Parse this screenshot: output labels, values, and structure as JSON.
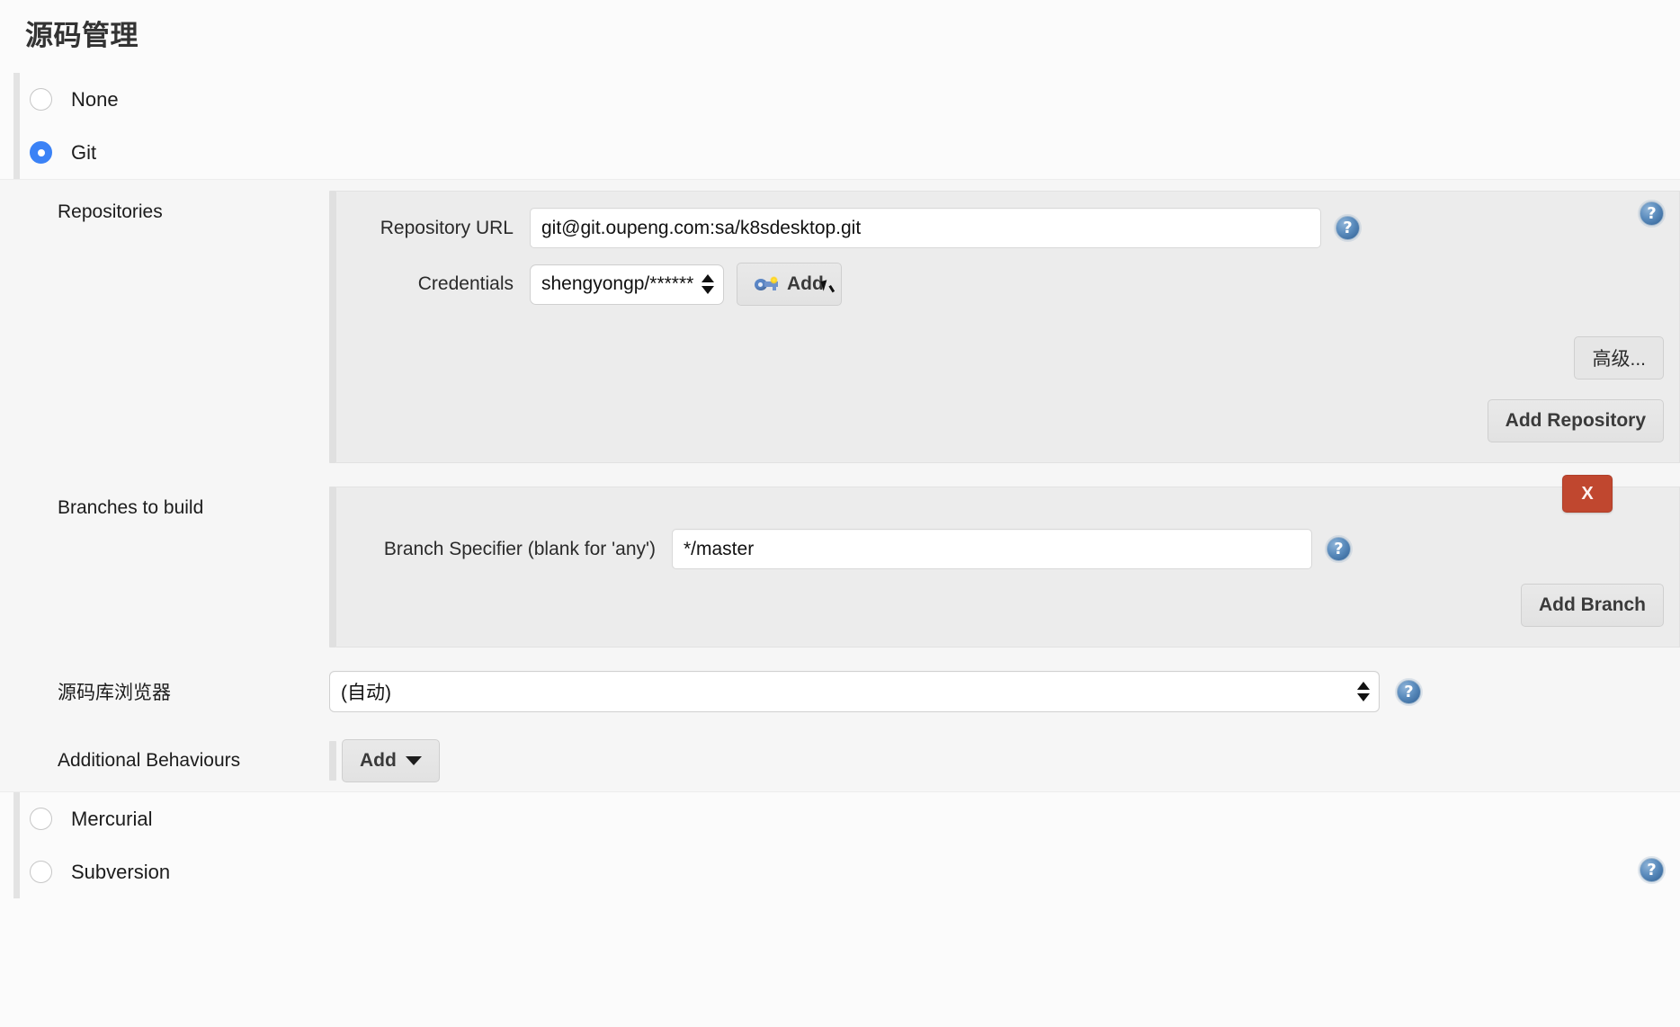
{
  "page": {
    "title": "源码管理"
  },
  "scm_options": [
    {
      "label": "None",
      "selected": false
    },
    {
      "label": "Git",
      "selected": true
    },
    {
      "label": "Mercurial",
      "selected": false
    },
    {
      "label": "Subversion",
      "selected": false
    }
  ],
  "git": {
    "repositories": {
      "label": "Repositories",
      "repository_url": {
        "label": "Repository URL",
        "value": "git@git.oupeng.com:sa/k8sdesktop.git",
        "placeholder": ""
      },
      "credentials": {
        "label": "Credentials",
        "value": "shengyongp/******",
        "add_button": "Add",
        "add_icon": "key-icon"
      },
      "advanced_button": "高级...",
      "add_repository_button": "Add Repository"
    },
    "branches": {
      "label": "Branches to build",
      "branch_specifier": {
        "label": "Branch Specifier (blank for 'any')",
        "value": "*/master",
        "placeholder": ""
      },
      "delete_button": "X",
      "add_branch_button": "Add Branch"
    },
    "repository_browser": {
      "label": "源码库浏览器",
      "value": "(自动)"
    },
    "additional_behaviours": {
      "label": "Additional Behaviours",
      "add_button": "Add",
      "caret_icon": "chevron-down-icon"
    }
  },
  "icons": {
    "help": "?",
    "help_name": "help-icon"
  },
  "colors": {
    "accent": "#3b82f6",
    "danger": "#c0472f",
    "panel": "#ececec",
    "page": "#fbfbfb"
  }
}
